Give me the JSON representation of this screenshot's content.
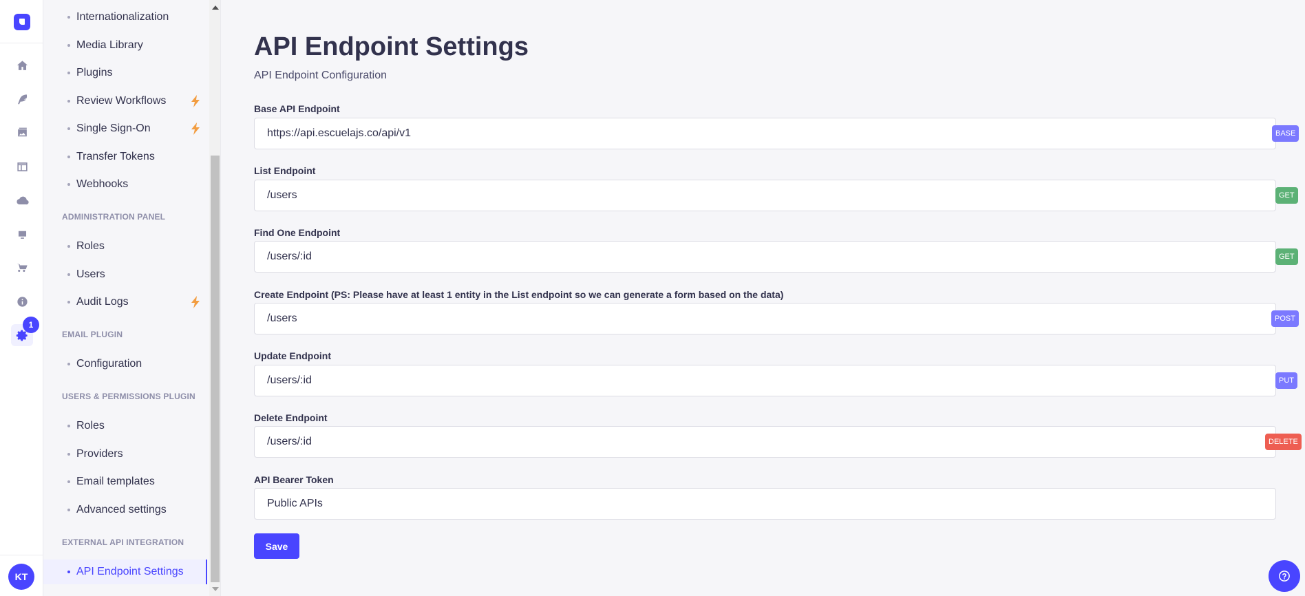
{
  "rail": {
    "notification_count": "1",
    "avatar_initials": "KT",
    "icons": [
      "logo-icon",
      "home-icon",
      "feather-icon",
      "media-icon",
      "layout-icon",
      "cloud-icon",
      "monitor-icon",
      "cart-icon",
      "info-icon",
      "settings-icon"
    ]
  },
  "subnav": {
    "items_top": [
      {
        "label": "Internationalization"
      },
      {
        "label": "Media Library"
      },
      {
        "label": "Plugins"
      },
      {
        "label": "Review Workflows",
        "bolt": true
      },
      {
        "label": "Single Sign-On",
        "bolt": true
      },
      {
        "label": "Transfer Tokens"
      },
      {
        "label": "Webhooks"
      }
    ],
    "sections": [
      {
        "title": "Administration Panel",
        "items": [
          {
            "label": "Roles"
          },
          {
            "label": "Users"
          },
          {
            "label": "Audit Logs",
            "bolt": true
          }
        ]
      },
      {
        "title": "Email Plugin",
        "items": [
          {
            "label": "Configuration"
          }
        ]
      },
      {
        "title": "Users & Permissions Plugin",
        "items": [
          {
            "label": "Roles"
          },
          {
            "label": "Providers"
          },
          {
            "label": "Email templates"
          },
          {
            "label": "Advanced settings"
          }
        ]
      },
      {
        "title": "External API Integration",
        "items": [
          {
            "label": "API Endpoint Settings",
            "active": true
          }
        ]
      }
    ]
  },
  "page": {
    "title": "API Endpoint Settings",
    "subtitle": "API Endpoint Configuration"
  },
  "form": {
    "fields": [
      {
        "label": "Base API Endpoint",
        "value": "https://api.escuelajs.co/api/v1",
        "badge": "BASE",
        "badge_color": "#7b79ff"
      },
      {
        "label": "List Endpoint",
        "value": "/users",
        "badge": "GET",
        "badge_color": "#5cb176"
      },
      {
        "label": "Find One Endpoint",
        "value": "/users/:id",
        "badge": "GET",
        "badge_color": "#5cb176"
      },
      {
        "label": "Create Endpoint (PS: Please have at least 1 entity in the List endpoint so we can generate a form based on the data)",
        "value": "/users",
        "badge": "POST",
        "badge_color": "#7b79ff"
      },
      {
        "label": "Update Endpoint",
        "value": "/users/:id",
        "badge": "PUT",
        "badge_color": "#7b79ff"
      },
      {
        "label": "Delete Endpoint",
        "value": "/users/:id",
        "badge": "DELETE",
        "badge_color": "#ee5e52"
      },
      {
        "label": "API Bearer Token",
        "value": "Public APIs"
      }
    ],
    "save_label": "Save"
  },
  "colors": {
    "primary": "#4945ff",
    "bolt": "#f29d41",
    "get": "#5cb176",
    "delete": "#ee5e52",
    "accent_badge": "#7b79ff"
  }
}
